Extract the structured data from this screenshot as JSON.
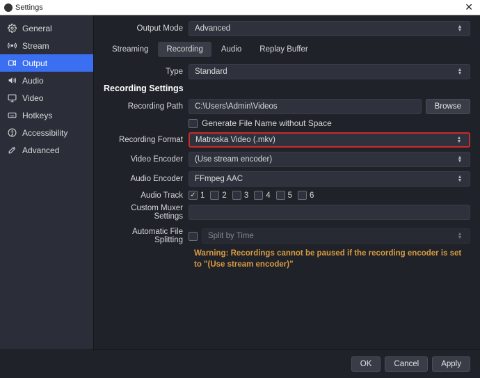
{
  "window": {
    "title": "Settings"
  },
  "sidebar": {
    "items": [
      {
        "label": "General"
      },
      {
        "label": "Stream"
      },
      {
        "label": "Output"
      },
      {
        "label": "Audio"
      },
      {
        "label": "Video"
      },
      {
        "label": "Hotkeys"
      },
      {
        "label": "Accessibility"
      },
      {
        "label": "Advanced"
      }
    ]
  },
  "outputMode": {
    "label": "Output Mode",
    "value": "Advanced"
  },
  "tabs": [
    {
      "label": "Streaming"
    },
    {
      "label": "Recording"
    },
    {
      "label": "Audio"
    },
    {
      "label": "Replay Buffer"
    }
  ],
  "type": {
    "label": "Type",
    "value": "Standard"
  },
  "sectionTitle": "Recording Settings",
  "recordingPath": {
    "label": "Recording Path",
    "value": "C:\\Users\\Admin\\Videos",
    "browse": "Browse"
  },
  "genFilename": {
    "label": "Generate File Name without Space",
    "checked": false
  },
  "recordingFormat": {
    "label": "Recording Format",
    "value": "Matroska Video (.mkv)"
  },
  "videoEncoder": {
    "label": "Video Encoder",
    "value": "(Use stream encoder)"
  },
  "audioEncoder": {
    "label": "Audio Encoder",
    "value": "FFmpeg AAC"
  },
  "audioTrack": {
    "label": "Audio Track",
    "tracks": [
      {
        "n": "1",
        "checked": true
      },
      {
        "n": "2",
        "checked": false
      },
      {
        "n": "3",
        "checked": false
      },
      {
        "n": "4",
        "checked": false
      },
      {
        "n": "5",
        "checked": false
      },
      {
        "n": "6",
        "checked": false
      }
    ]
  },
  "customMuxer": {
    "label": "Custom Muxer Settings",
    "value": ""
  },
  "autoSplit": {
    "label": "Automatic File Splitting",
    "checked": false,
    "value": "Split by Time"
  },
  "warning": "Warning: Recordings cannot be paused if the recording encoder is set to \"(Use stream encoder)\"",
  "footer": {
    "ok": "OK",
    "cancel": "Cancel",
    "apply": "Apply"
  }
}
